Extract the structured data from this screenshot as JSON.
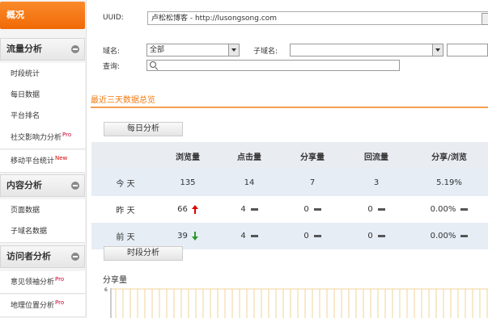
{
  "sidebar": {
    "overview": "概况",
    "sections": [
      {
        "title": "流量分析",
        "items": [
          {
            "label": "时段统计",
            "sup": ""
          },
          {
            "label": "每日数据",
            "sup": ""
          },
          {
            "label": "平台排名",
            "sup": ""
          },
          {
            "label": "社交影响力分析",
            "sup": "Pro"
          },
          {
            "label": "移动平台统计",
            "sup": "New"
          }
        ]
      },
      {
        "title": "内容分析",
        "items": [
          {
            "label": "页面数据",
            "sup": ""
          },
          {
            "label": "子域名数据",
            "sup": ""
          }
        ]
      },
      {
        "title": "访问者分析",
        "items": [
          {
            "label": "意见领袖分析",
            "sup": "Pro"
          },
          {
            "label": "地理位置分析",
            "sup": "Pro"
          }
        ]
      }
    ]
  },
  "filters": {
    "uuid_label": "UUID:",
    "uuid_value": "卢松松博客 - http://lusongsong.com",
    "domain_label": "域名:",
    "domain_value": "全部",
    "subdomain_label": "子域名:",
    "subdomain_value": "",
    "query_label": "查询:"
  },
  "summary": {
    "title": "最近三天数据总览",
    "daily_tab": "每日分析",
    "columns": [
      "",
      "浏览量",
      "点击量",
      "分享量",
      "回流量",
      "分享/浏览"
    ],
    "rows": [
      {
        "day": "今 天",
        "views": "135",
        "clicks": "14",
        "shares": "7",
        "backflow": "3",
        "ratio": "5.19%",
        "trend": {
          "views": "",
          "clicks": "",
          "shares": "",
          "backflow": "",
          "ratio": ""
        }
      },
      {
        "day": "昨 天",
        "views": "66",
        "clicks": "4",
        "shares": "0",
        "backflow": "0",
        "ratio": "0.00%",
        "trend": {
          "views": "up",
          "clicks": "flat",
          "shares": "flat",
          "backflow": "flat",
          "ratio": "flat"
        }
      },
      {
        "day": "前 天",
        "views": "39",
        "clicks": "4",
        "shares": "0",
        "backflow": "0",
        "ratio": "0.00%",
        "trend": {
          "views": "down",
          "clicks": "flat",
          "shares": "flat",
          "backflow": "flat",
          "ratio": "flat"
        }
      }
    ]
  },
  "period": {
    "tab": "时段分析",
    "chart_title": "分享量"
  },
  "chart_data": {
    "type": "bar",
    "title": "分享量",
    "ylim": [
      0,
      6
    ],
    "yticks": [
      "6"
    ],
    "grid": true
  },
  "colors": {
    "accent": "#f07a10",
    "up": "#dd0000",
    "down": "#2a9a2a"
  }
}
